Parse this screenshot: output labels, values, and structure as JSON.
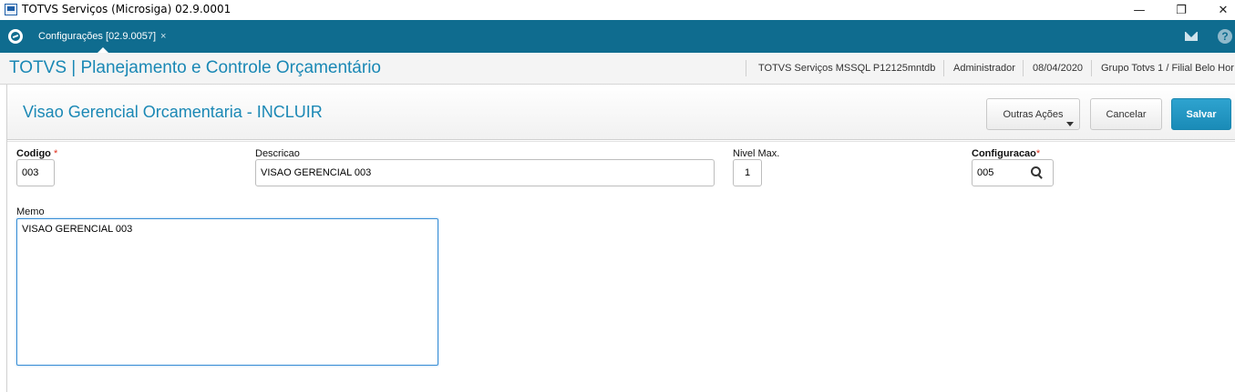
{
  "window": {
    "title": "TOTVS Serviços (Microsiga) 02.9.0001",
    "minimize": "—",
    "restore": "❐",
    "close": "✕"
  },
  "tabs": [
    {
      "label": "Configurações [02.9.0057]",
      "close": "×"
    }
  ],
  "module": {
    "title": "TOTVS | Planejamento e Controle Orçamentário",
    "environment": "TOTVS Serviços MSSQL P12125mntdb",
    "user": "Administrador",
    "date": "08/04/2020",
    "branch": "Grupo Totvs 1 / Filial Belo Hor"
  },
  "page": {
    "title": "Visao Gerencial Orcamentaria - INCLUIR",
    "actions": {
      "more": "Outras Ações",
      "cancel": "Cancelar",
      "save": "Salvar"
    }
  },
  "form": {
    "codigo": {
      "label": "Codigo",
      "required_mark": "*",
      "value": "003"
    },
    "descricao": {
      "label": "Descricao",
      "value": "VISAO GERENCIAL 003"
    },
    "nivel_max": {
      "label": "Nivel Max.",
      "value": "1"
    },
    "configuracao": {
      "label": "Configuracao",
      "required_mark": "*",
      "value": "005"
    },
    "memo": {
      "label": "Memo",
      "value": "VISAO GERENCIAL 003"
    }
  },
  "icons": {
    "app": "app-window-icon",
    "logo": "totvs-logo-icon",
    "mail": "mail-icon",
    "help": "help-icon",
    "lookup": "search-icon"
  },
  "colors": {
    "tabstrip": "#0f6c8f",
    "title_blue": "#1a88b5",
    "save_button": "#1a8bb7",
    "required": "#e0301e"
  }
}
